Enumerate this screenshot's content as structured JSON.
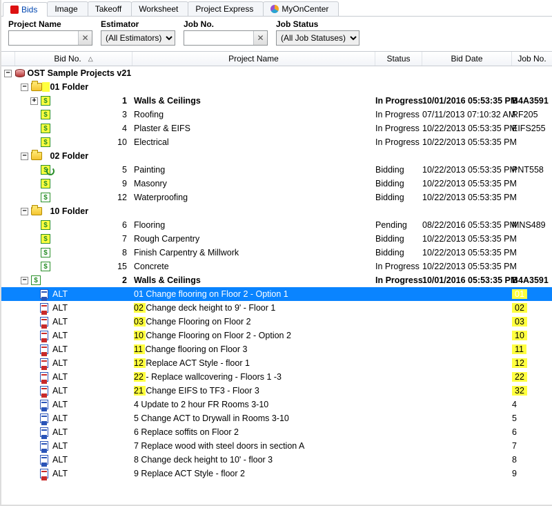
{
  "tabs": [
    "Bids",
    "Image",
    "Takeoff",
    "Worksheet",
    "Project Express",
    "MyOnCenter"
  ],
  "active_tab_index": 0,
  "filters": {
    "project_name": {
      "label": "Project Name",
      "value": ""
    },
    "estimator": {
      "label": "Estimator",
      "selected": "(All Estimators)"
    },
    "job_no": {
      "label": "Job No.",
      "value": ""
    },
    "job_status": {
      "label": "Job Status",
      "selected": "(All Job Statuses)"
    }
  },
  "columns": {
    "bidno": "Bid No.",
    "name": "Project Name",
    "status": "Status",
    "date": "Bid Date",
    "jobno": "Job No."
  },
  "root": {
    "label": "OST Sample Projects v21"
  },
  "folders": [
    {
      "name": "01 Folder",
      "exp": true,
      "hl": true,
      "items": [
        {
          "no": "1",
          "name": "Walls & Ceilings",
          "status": "In Progress",
          "date": "10/01/2016 05:53:35 PM",
          "job": "B4A3591",
          "bold": true,
          "exp": "+",
          "hl": true
        },
        {
          "no": "3",
          "name": "Roofing",
          "status": "In Progress",
          "date": "07/11/2013 07:10:32 AM",
          "job": "RF205",
          "hl": true
        },
        {
          "no": "4",
          "name": "Plaster & EIFS",
          "status": "In Progress",
          "date": "10/22/2013 05:53:35 PM",
          "job": "EIFS255",
          "hl": true
        },
        {
          "no": "10",
          "name": "Electrical",
          "status": "In Progress",
          "date": "10/22/2013 05:53:35 PM",
          "job": "",
          "hl": true
        }
      ]
    },
    {
      "name": "02 Folder",
      "exp": true,
      "items": [
        {
          "no": "5",
          "name": "Painting",
          "status": "Bidding",
          "date": "10/22/2013 05:53:35 PM",
          "job": "PNT558",
          "refresh": true,
          "hl": true
        },
        {
          "no": "9",
          "name": "Masonry",
          "status": "Bidding",
          "date": "10/22/2013 05:53:35 PM",
          "job": "",
          "hl": true
        },
        {
          "no": "12",
          "name": "Waterproofing",
          "status": "Bidding",
          "date": "10/22/2013 05:53:35 PM",
          "job": ""
        }
      ]
    },
    {
      "name": "10 Folder",
      "exp": true,
      "items": [
        {
          "no": "6",
          "name": "Flooring",
          "status": "Pending",
          "date": "08/22/2016 05:53:35 PM",
          "job": "MNS489",
          "hl": true
        },
        {
          "no": "7",
          "name": "Rough Carpentry",
          "status": "Bidding",
          "date": "10/22/2013 05:53:35 PM",
          "job": "",
          "hl": true
        },
        {
          "no": "8",
          "name": "Finish Carpentry & Millwork",
          "status": "Bidding",
          "date": "10/22/2013 05:53:35 PM",
          "job": ""
        },
        {
          "no": "15",
          "name": "Concrete",
          "status": "In Progress",
          "date": "10/22/2013 05:53:35 PM",
          "job": ""
        }
      ]
    }
  ],
  "project2": {
    "no": "2",
    "name": "Walls & Ceilings",
    "status": "In Progress",
    "date": "10/01/2016 05:53:35 PM",
    "job": "B4A3591"
  },
  "alt_label": "ALT",
  "alts": [
    {
      "prefix": "01",
      "name": "Change flooring on Floor 2 - Option 1",
      "job": "01",
      "hl": true,
      "jobhl": true,
      "selected": true,
      "red": false
    },
    {
      "prefix": "02",
      "name": "Change deck height to 9' - Floor 1",
      "job": "02",
      "hl": true,
      "jobhl": true,
      "red": true
    },
    {
      "prefix": "03",
      "name": "Change Flooring on Floor 2",
      "job": "03",
      "hl": true,
      "jobhl": true,
      "red": true
    },
    {
      "prefix": "10",
      "name": "Change Flooring on Floor 2 - Option 2",
      "job": "10",
      "hl": true,
      "jobhl": true,
      "red": true
    },
    {
      "prefix": "11",
      "name": "Change flooring on Floor 3",
      "job": "11",
      "hl": true,
      "jobhl": true,
      "red": true
    },
    {
      "prefix": "12",
      "name": "Replace ACT Style - floor 1",
      "job": "12",
      "hl": true,
      "jobhl": true,
      "red": true
    },
    {
      "prefix": "22",
      "name": "- Replace wallcovering - Floors 1 -3",
      "job": "22",
      "hl": true,
      "jobhl": true,
      "red": true
    },
    {
      "prefix": "21",
      "name": "Change EIFS to TF3 - Floor 3",
      "job": "32",
      "hl": true,
      "jobhl": true,
      "red": true
    },
    {
      "prefix": "4",
      "name": "Update to 2 hour FR Rooms 3-10",
      "job": "4"
    },
    {
      "prefix": "5",
      "name": "Change ACT to Drywall in Rooms 3-10",
      "job": "5"
    },
    {
      "prefix": "6",
      "name": "Replace soffits on Floor 2",
      "job": "6"
    },
    {
      "prefix": "7",
      "name": "Replace wood with steel doors in section A",
      "job": "7"
    },
    {
      "prefix": "8",
      "name": "Change deck height to 10' - floor 3",
      "job": "8"
    },
    {
      "prefix": "9",
      "name": "Replace ACT Style - floor 2",
      "job": "9",
      "red": true
    }
  ]
}
